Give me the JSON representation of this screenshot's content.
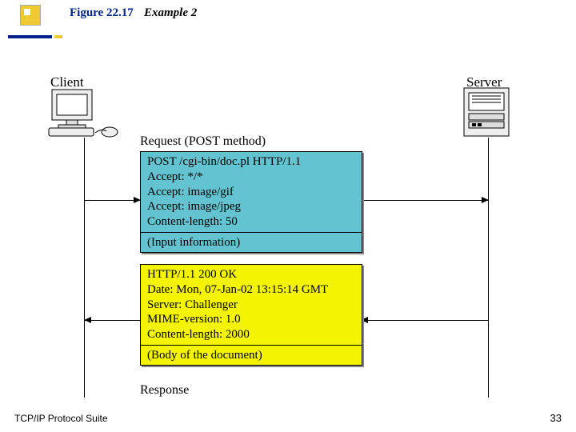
{
  "figure": {
    "label": "Figure 22.17",
    "title": "Example 2"
  },
  "client_label": "Client",
  "server_label": "Server",
  "request_caption": "Request (POST method)",
  "request": {
    "lines": [
      "POST   /cgi-bin/doc.pl  HTTP/1.1",
      "Accept: */*",
      "Accept: image/gif",
      "Accept: image/jpeg",
      "Content-length: 50"
    ],
    "body_note": "(Input information)"
  },
  "response": {
    "lines": [
      "HTTP/1.1   200  OK",
      "Date: Mon, 07-Jan-02 13:15:14 GMT",
      "Server: Challenger",
      "MIME-version: 1.0",
      "Content-length: 2000"
    ],
    "body_note": "(Body of the document)"
  },
  "response_caption": "Response",
  "footer": {
    "left": "TCP/IP Protocol Suite",
    "page": "33"
  }
}
